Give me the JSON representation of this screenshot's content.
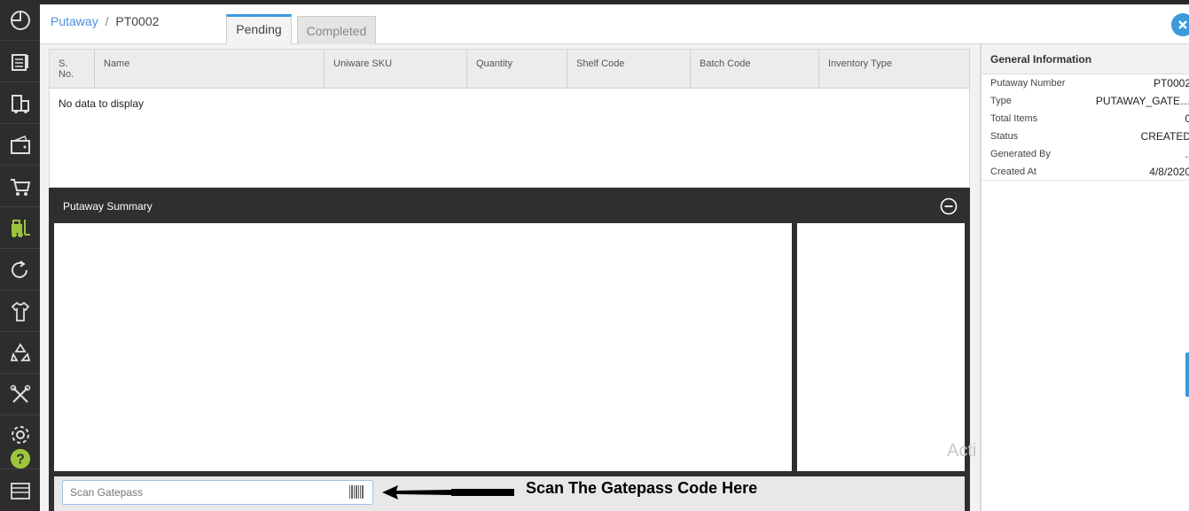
{
  "breadcrumb": {
    "parent": "Putaway",
    "separator": "/",
    "current": "PT0002"
  },
  "tabs": [
    {
      "label": "Pending",
      "active": true
    },
    {
      "label": "Completed",
      "active": false
    }
  ],
  "table": {
    "columns": [
      "S. No.",
      "Name",
      "Uniware SKU",
      "Quantity",
      "Shelf Code",
      "Batch Code",
      "Inventory Type"
    ],
    "empty_message": "No data to display"
  },
  "summary": {
    "title": "Putaway Summary",
    "scan_placeholder": "Scan Gatepass",
    "scan_annotation": "Scan The Gatepass Code Here"
  },
  "general_info": {
    "title": "General Information",
    "rows": [
      {
        "label": "Putaway Number",
        "value": "PT0002"
      },
      {
        "label": "Type",
        "value": "PUTAWAY_GATE…"
      },
      {
        "label": "Total Items",
        "value": "0"
      },
      {
        "label": "Status",
        "value": "CREATED"
      },
      {
        "label": "Generated By",
        "value": ".."
      },
      {
        "label": "Created At",
        "value": "4/8/2020"
      }
    ]
  },
  "watermark": "Acti",
  "sidebar_icons": [
    "dashboard-icon",
    "orders-icon",
    "shipping-icon",
    "wallet-icon",
    "cart-icon",
    "forklift-icon",
    "returns-icon",
    "apparel-icon",
    "recycle-icon",
    "tools-icon",
    "settings-icon",
    "help-icon"
  ],
  "colors": {
    "accent": "#3a9ad9",
    "sidebar": "#2d2d2d",
    "forklift_active": "#9bc53d",
    "help": "#9bc53d"
  }
}
